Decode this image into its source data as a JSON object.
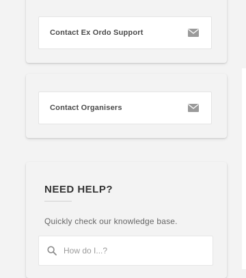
{
  "contacts": {
    "support_label": "Contact Ex Ordo Support",
    "organisers_label": "Contact Organisers",
    "icon": "envelope-icon"
  },
  "help": {
    "title": "NEED HELP?",
    "description": "Quickly check our knowledge base.",
    "search_placeholder": "How do I...?",
    "search_value": "",
    "icon": "search-icon"
  },
  "colors": {
    "background": "#f3f3f3",
    "card": "#ffffff",
    "text_dark": "#4a4a4a",
    "icon": "#9a9a9a"
  }
}
